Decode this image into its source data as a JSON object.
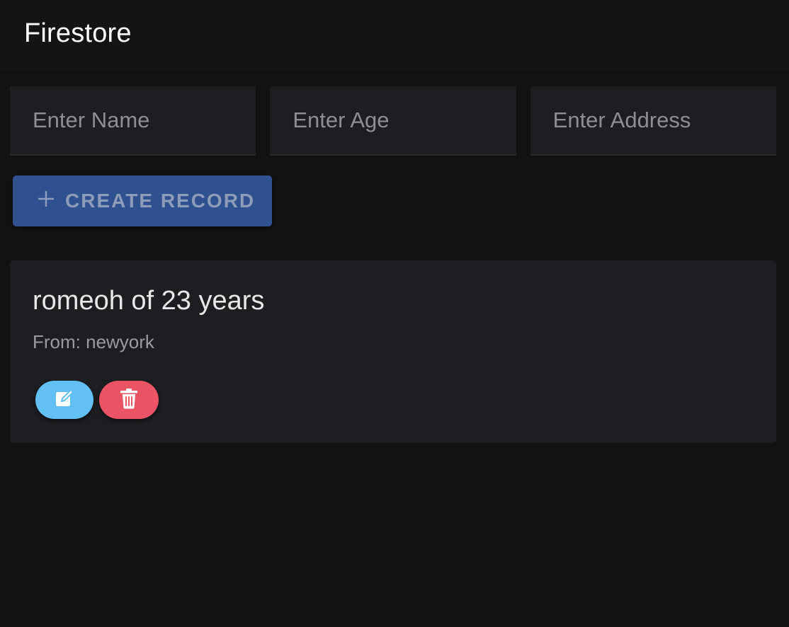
{
  "header": {
    "title": "Firestore"
  },
  "form": {
    "name_placeholder": "Enter Name",
    "age_placeholder": "Enter Age",
    "address_placeholder": "Enter Address",
    "create_label": "CREATE RECORD",
    "create_icon": "plus-icon"
  },
  "records": [
    {
      "title": "romeoh of 23 years",
      "subtitle": "From: newyork",
      "edit_icon": "edit-icon",
      "delete_icon": "trash-icon"
    }
  ],
  "colors": {
    "background": "#121212",
    "surface": "#1d1e22",
    "primary_button": "#2f5190",
    "edit_button": "#62c0f5",
    "delete_button": "#ea5464"
  }
}
